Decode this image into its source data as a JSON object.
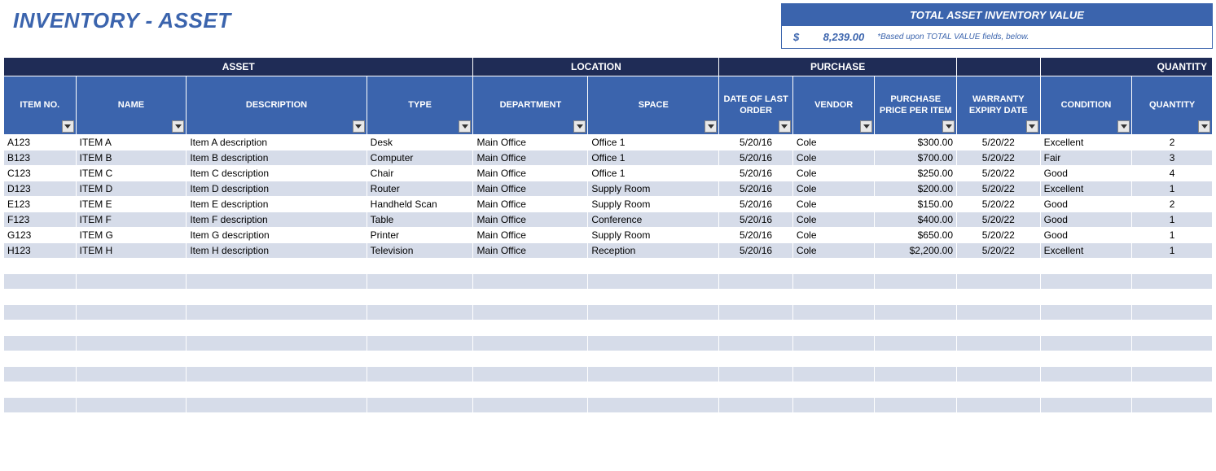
{
  "title": "INVENTORY - ASSET",
  "total_box": {
    "header": "TOTAL ASSET INVENTORY VALUE",
    "currency": "$",
    "value": "8,239.00",
    "note": "*Based upon TOTAL VALUE fields, below."
  },
  "group_headers": {
    "asset": "ASSET",
    "location": "LOCATION",
    "purchase": "PURCHASE",
    "blank": "",
    "quantity": "QUANTITY"
  },
  "columns": {
    "item_no": "ITEM NO.",
    "name": "NAME",
    "description": "DESCRIPTION",
    "type": "TYPE",
    "department": "DEPARTMENT",
    "space": "SPACE",
    "date_last_order": "DATE OF LAST ORDER",
    "vendor": "VENDOR",
    "price_per_item": "PURCHASE PRICE PER ITEM",
    "warranty_expiry": "WARRANTY EXPIRY DATE",
    "condition": "CONDITION",
    "quantity": "QUANTITY"
  },
  "rows": [
    {
      "item_no": "A123",
      "name": "ITEM A",
      "description": "Item A description",
      "type": "Desk",
      "department": "Main Office",
      "space": "Office 1",
      "date": "5/20/16",
      "vendor": "Cole",
      "price": "$300.00",
      "warranty": "5/20/22",
      "condition": "Excellent",
      "quantity": "2"
    },
    {
      "item_no": "B123",
      "name": "ITEM B",
      "description": "Item B description",
      "type": "Computer",
      "department": "Main Office",
      "space": "Office 1",
      "date": "5/20/16",
      "vendor": "Cole",
      "price": "$700.00",
      "warranty": "5/20/22",
      "condition": "Fair",
      "quantity": "3"
    },
    {
      "item_no": "C123",
      "name": "ITEM C",
      "description": "Item C description",
      "type": "Chair",
      "department": "Main Office",
      "space": "Office 1",
      "date": "5/20/16",
      "vendor": "Cole",
      "price": "$250.00",
      "warranty": "5/20/22",
      "condition": "Good",
      "quantity": "4"
    },
    {
      "item_no": "D123",
      "name": "ITEM D",
      "description": "Item D description",
      "type": "Router",
      "department": "Main Office",
      "space": "Supply Room",
      "date": "5/20/16",
      "vendor": "Cole",
      "price": "$200.00",
      "warranty": "5/20/22",
      "condition": "Excellent",
      "quantity": "1"
    },
    {
      "item_no": "E123",
      "name": "ITEM E",
      "description": "Item E description",
      "type": "Handheld Scan",
      "department": "Main Office",
      "space": "Supply Room",
      "date": "5/20/16",
      "vendor": "Cole",
      "price": "$150.00",
      "warranty": "5/20/22",
      "condition": "Good",
      "quantity": "2"
    },
    {
      "item_no": "F123",
      "name": "ITEM F",
      "description": "Item F description",
      "type": "Table",
      "department": "Main Office",
      "space": "Conference",
      "date": "5/20/16",
      "vendor": "Cole",
      "price": "$400.00",
      "warranty": "5/20/22",
      "condition": "Good",
      "quantity": "1"
    },
    {
      "item_no": "G123",
      "name": "ITEM G",
      "description": "Item G description",
      "type": "Printer",
      "department": "Main Office",
      "space": "Supply Room",
      "date": "5/20/16",
      "vendor": "Cole",
      "price": "$650.00",
      "warranty": "5/20/22",
      "condition": "Good",
      "quantity": "1"
    },
    {
      "item_no": "H123",
      "name": "ITEM H",
      "description": "Item H description",
      "type": "Television",
      "department": "Main Office",
      "space": "Reception",
      "date": "5/20/16",
      "vendor": "Cole",
      "price": "$2,200.00",
      "warranty": "5/20/22",
      "condition": "Excellent",
      "quantity": "1"
    }
  ],
  "empty_rows": 11
}
